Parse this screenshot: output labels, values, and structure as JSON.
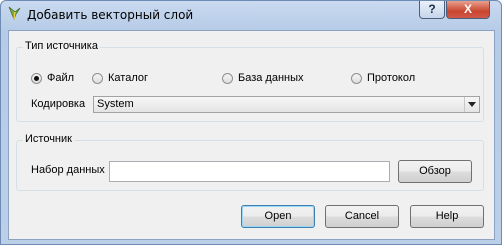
{
  "window": {
    "title": "Добавить векторный слой",
    "help_glyph": "?",
    "close_glyph": "X"
  },
  "source_type": {
    "group_title": "Тип источника",
    "options": [
      {
        "label": "Файл",
        "checked": true
      },
      {
        "label": "Каталог",
        "checked": false
      },
      {
        "label": "База данных",
        "checked": false
      },
      {
        "label": "Протокол",
        "checked": false
      }
    ],
    "encoding_label": "Кодировка",
    "encoding_value": "System"
  },
  "source": {
    "group_title": "Источник",
    "dataset_label": "Набор данных",
    "dataset_value": "",
    "browse_label": "Обзор"
  },
  "buttons": {
    "open": "Open",
    "cancel": "Cancel",
    "help": "Help"
  }
}
